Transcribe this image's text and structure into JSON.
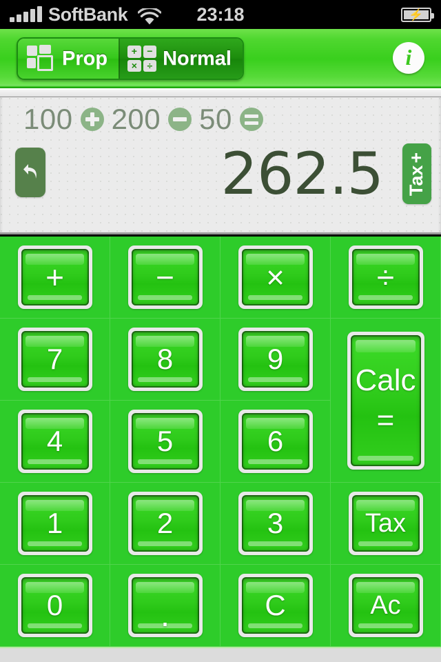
{
  "status_bar": {
    "carrier": "SoftBank",
    "time": "23:18",
    "signal_icon": "signal-bars-icon",
    "wifi_icon": "wifi-icon",
    "battery_icon": "battery-charging-icon",
    "signal_bars": 5
  },
  "toolbar": {
    "segments": [
      {
        "label": "Prop",
        "icon": "proportion-blocks-icon",
        "selected": false
      },
      {
        "label": "Normal",
        "icon": "operators-grid-icon",
        "selected": true
      }
    ],
    "operator_icons": [
      "+",
      "−",
      "×",
      "÷"
    ],
    "info_button": {
      "label": "i",
      "icon": "info-icon"
    }
  },
  "display": {
    "expression": {
      "tokens": [
        {
          "type": "number",
          "text": "100"
        },
        {
          "type": "operator",
          "name": "plus-badge"
        },
        {
          "type": "number",
          "text": "200"
        },
        {
          "type": "operator",
          "name": "minus-badge"
        },
        {
          "type": "number",
          "text": "50"
        },
        {
          "type": "operator",
          "name": "equals-badge"
        }
      ],
      "text": "100 + 200 - 50 ="
    },
    "result": "262.5",
    "undo_button": {
      "icon": "undo-arrow-icon",
      "label": ""
    },
    "tax_tab": {
      "label": "Tax",
      "suffix": "+",
      "icon": "tax-plus-icon"
    }
  },
  "keypad": {
    "keys": [
      {
        "label": "+",
        "name": "key-plus",
        "style": "sym",
        "span": 1
      },
      {
        "label": "−",
        "name": "key-minus",
        "style": "sym",
        "span": 1
      },
      {
        "label": "×",
        "name": "key-multiply",
        "style": "sym",
        "span": 1
      },
      {
        "label": "÷",
        "name": "key-divide",
        "style": "sym",
        "span": 1
      },
      {
        "label": "7",
        "name": "key-7",
        "style": "num",
        "span": 1
      },
      {
        "label": "8",
        "name": "key-8",
        "style": "num",
        "span": 1
      },
      {
        "label": "9",
        "name": "key-9",
        "style": "num",
        "span": 1
      },
      {
        "label": "Calc",
        "name": "key-calc-equals",
        "style": "calc",
        "span": 2,
        "label2": "="
      },
      {
        "label": "4",
        "name": "key-4",
        "style": "num",
        "span": 1
      },
      {
        "label": "5",
        "name": "key-5",
        "style": "num",
        "span": 1
      },
      {
        "label": "6",
        "name": "key-6",
        "style": "num",
        "span": 1
      },
      {
        "label": "1",
        "name": "key-1",
        "style": "num",
        "span": 1
      },
      {
        "label": "2",
        "name": "key-2",
        "style": "num",
        "span": 1
      },
      {
        "label": "3",
        "name": "key-3",
        "style": "num",
        "span": 1
      },
      {
        "label": "Tax",
        "name": "key-tax",
        "style": "small",
        "span": 1
      },
      {
        "label": "0",
        "name": "key-0",
        "style": "num",
        "span": 1
      },
      {
        "label": ".",
        "name": "key-decimal",
        "style": "dot",
        "span": 1
      },
      {
        "label": "C",
        "name": "key-clear",
        "style": "num",
        "span": 1
      },
      {
        "label": "Ac",
        "name": "key-all-clear",
        "style": "small",
        "span": 1
      }
    ]
  },
  "colors": {
    "brand_green": "#2ecc2a",
    "toolbar_green": "#39cf1d",
    "selected_segment": "#1d8d0d",
    "key_face": "#2fcb1b",
    "display_bg": "#ebebeb",
    "result_text": "#3c4f35",
    "expression_text": "#7e8f7c",
    "op_badge": "#8cb487",
    "undo_button": "#56814b",
    "tax_tab": "#45a247",
    "bottom_bar": "#dcdcdc",
    "status_bar_bg": "#000000"
  }
}
